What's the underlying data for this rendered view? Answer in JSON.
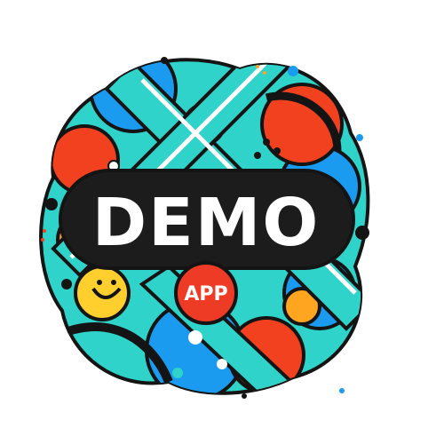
{
  "logo": {
    "title": "DEMO",
    "subtitle": "APP"
  },
  "colors": {
    "background": "#ffffff",
    "outline": "#141414",
    "teal": "#2fd3c9",
    "blue": "#1a9bf0",
    "red": "#f2411f",
    "orange": "#ffa51f",
    "yellow": "#ffcf2e",
    "banner": "#1c1c1c",
    "text": "#ffffff",
    "badge": "#ee3b25"
  }
}
